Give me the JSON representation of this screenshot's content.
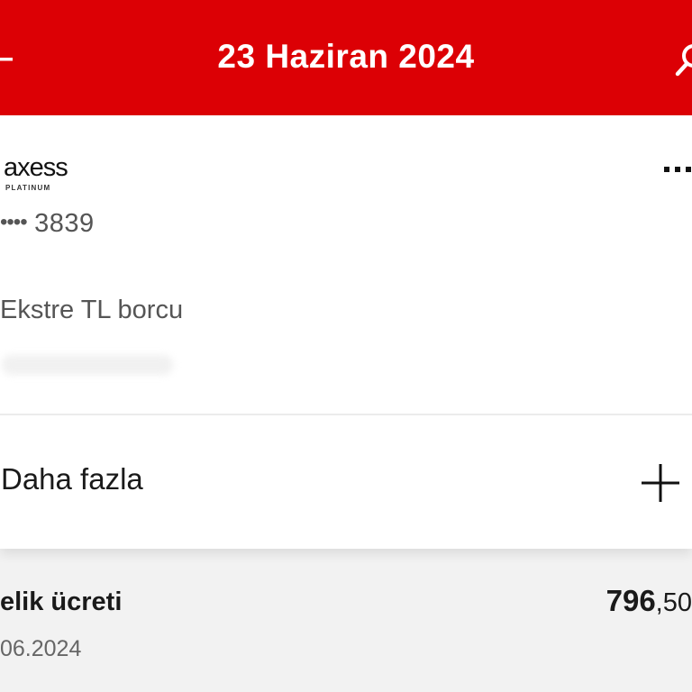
{
  "header": {
    "title": "23 Haziran 2024"
  },
  "card": {
    "brand": "axess",
    "tier": "PLATINUM",
    "number_mask": "••••",
    "number_last4": "3839",
    "debt_label": "Ekstre TL borcu",
    "more_label": "Daha fazla"
  },
  "transactions": [
    {
      "name": "elik ücreti",
      "amount_int": "796",
      "amount_dec": ",50",
      "date": "06.2024"
    }
  ],
  "colors": {
    "brand_red": "#dc0005"
  }
}
